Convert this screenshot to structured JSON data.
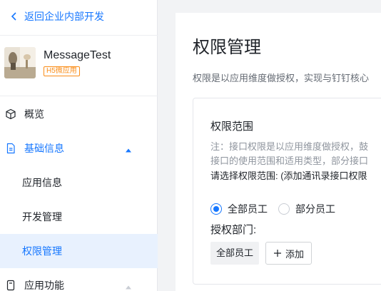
{
  "sidebar": {
    "back_label": "返回企业内部开发",
    "app": {
      "name": "MessageTest",
      "tag": "H5微应用"
    },
    "nav": {
      "overview": "概览",
      "basic_info": "基础信息",
      "app_info": "应用信息",
      "dev_manage": "开发管理",
      "permission_manage": "权限管理",
      "app_features": "应用功能"
    }
  },
  "main": {
    "title": "权限管理",
    "description": "权限是以应用维度做授权，实现与钉钉核心",
    "card": {
      "title": "权限范围",
      "note_line1": "注：接口权限是以应用维度做授权，鼓",
      "note_line2": "接口的使用范围和适用类型，部分接口",
      "select_line": "请选择权限范围: (添加通讯录接口权限",
      "radio_all": "全部员工",
      "radio_partial": "部分员工",
      "dept_label": "授权部门:",
      "dept_chip": "全部员工",
      "add_label": "添加"
    }
  },
  "colors": {
    "accent": "#1677ff",
    "active_bg": "#e8f1fe",
    "tag": "#fa8c16"
  },
  "icons": [
    "chevron-left-icon",
    "cube-icon",
    "document-icon",
    "caret-up-icon",
    "app-features-icon",
    "plus-icon"
  ]
}
